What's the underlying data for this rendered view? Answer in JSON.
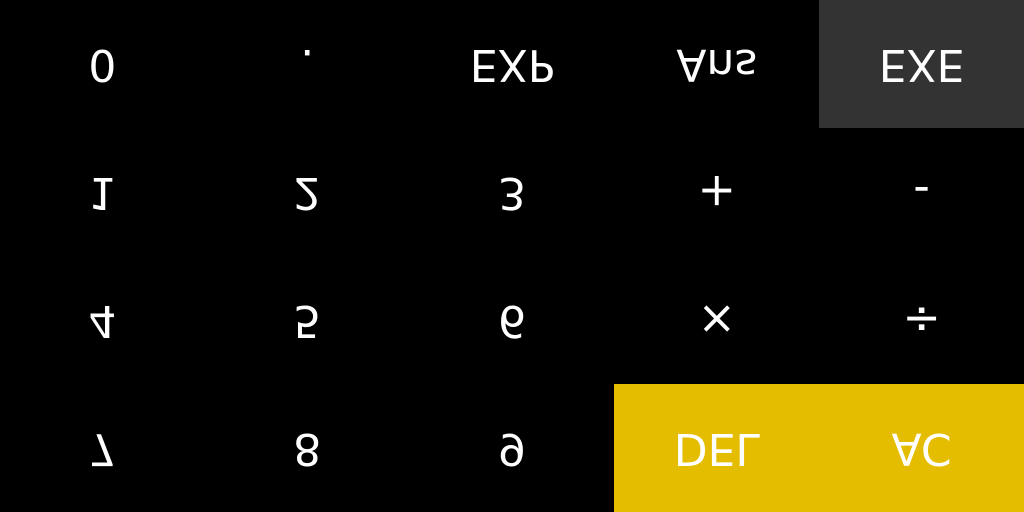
{
  "colors": {
    "background": "#000000",
    "key_text": "#ffffff",
    "exe_key": "#333333",
    "accent_yellow": "#e5bd00"
  },
  "keypad": {
    "row1": {
      "key0": "0",
      "dot": ".",
      "exp": "EXP",
      "ans": "Ans",
      "exe": "EXE"
    },
    "row2": {
      "key1": "1",
      "key2": "2",
      "key3": "3",
      "plus": "+",
      "minus": "-"
    },
    "row3": {
      "key4": "4",
      "key5": "5",
      "key6": "6",
      "times": "×",
      "divide": "÷"
    },
    "row4": {
      "key7": "7",
      "key8": "8",
      "key9": "9",
      "del": "DEL",
      "ac": "AC"
    }
  }
}
